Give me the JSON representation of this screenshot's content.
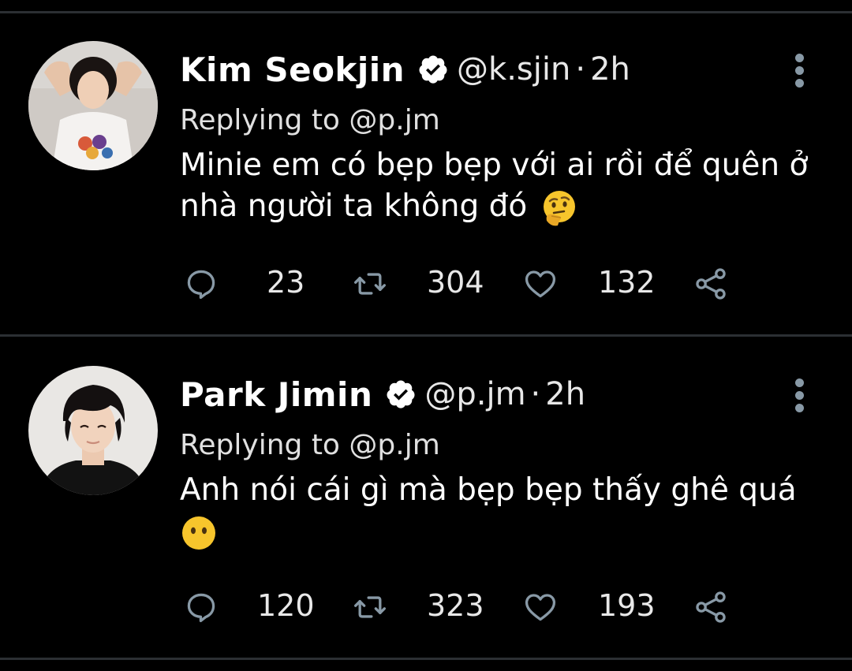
{
  "tweets": [
    {
      "name": "Kim Seokjin",
      "handle": "@k.sjin",
      "separator": "·",
      "time": "2h",
      "replying_prefix": "Replying to ",
      "replying_handle": "@p.jm",
      "text_line1": "Minie em có bẹp bẹp với ai rồi để quên ở",
      "text_line2": "nhà người ta không đó",
      "emoji": "thinking-face",
      "counts": {
        "replies": "23",
        "retweets": "304",
        "likes": "132"
      }
    },
    {
      "name": "Park Jimin",
      "handle": "@p.jm",
      "separator": "·",
      "time": "2h",
      "replying_prefix": "Replying to ",
      "replying_handle": "@p.jm",
      "text_line1": "Anh nói cái gì mà bẹp bẹp thấy ghê quá",
      "text_line2": "",
      "emoji": "face-without-mouth",
      "counts": {
        "replies": "120",
        "retweets": "323",
        "likes": "193"
      }
    }
  ],
  "colors": {
    "background": "#000000",
    "divider": "#2b2f33",
    "icon": "#8899a6",
    "text": "#ffffff"
  }
}
